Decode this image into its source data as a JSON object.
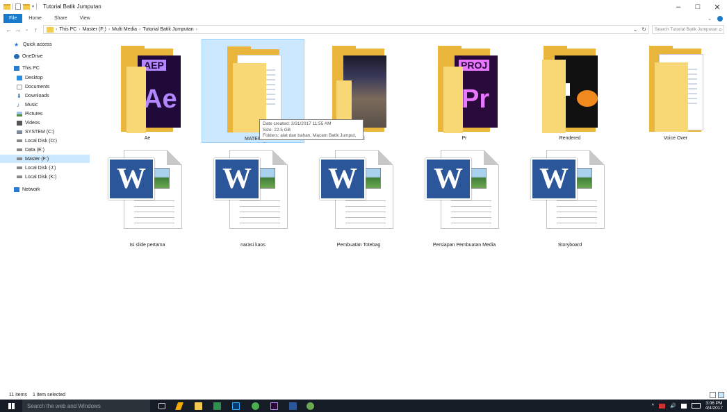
{
  "titlebar": {
    "title": "Tutorial Batik Jumputan",
    "controls": [
      "–",
      "□",
      "✕"
    ]
  },
  "ribbon": {
    "tabs": [
      "File",
      "Home",
      "Share",
      "View"
    ]
  },
  "address": {
    "crumbs": [
      "This PC",
      "Master (F:)",
      "Multi Media",
      "Tutorial Batik Jumputan"
    ],
    "search_placeholder": "Search Tutorial Batik Jumputan"
  },
  "navpane": {
    "items": [
      "Quick access",
      "OneDrive",
      "This PC",
      "Desktop",
      "Documents",
      "Downloads",
      "Music",
      "Pictures",
      "Videos",
      "SYSTEM (C:)",
      "Local Disk (D:)",
      "Data (E:)",
      "Master (F:)",
      "Local Disk (J:)",
      "Local Disk (K:)",
      "Network"
    ],
    "selected": "Master (F:)"
  },
  "items": [
    {
      "name": "Ae",
      "type": "folder",
      "art": "ae",
      "art_text": "AEP",
      "art_big": "Ae"
    },
    {
      "name": "MATERI",
      "type": "folder",
      "art": "doc",
      "selected": true
    },
    {
      "name": "Music",
      "type": "folder",
      "art": "picture"
    },
    {
      "name": "Pr",
      "type": "folder",
      "art": "pr",
      "art_text": "PROJ",
      "art_big": "Pr"
    },
    {
      "name": "Rendered",
      "type": "folder",
      "art": "rendered"
    },
    {
      "name": "Voice Over",
      "type": "folder",
      "art": "doc"
    },
    {
      "name": "Isi slide pertama",
      "type": "word-doc"
    },
    {
      "name": "narasi kaos",
      "type": "word-doc"
    },
    {
      "name": "Pembuatan Totebag",
      "type": "word-doc"
    },
    {
      "name": "Persiapan Pembuatan Media",
      "type": "word-doc"
    },
    {
      "name": "Storyboard",
      "type": "word-doc"
    }
  ],
  "tooltip": {
    "line1": "Date created: 3/31/2017 11:55 AM",
    "line2": "Size: 22.5 GB",
    "line3": "Folders: alat dan bahan, Macam Batik Jumput, ..."
  },
  "statusbar": {
    "count": "11 items",
    "selection": "1 item selected"
  },
  "taskbar": {
    "search_placeholder": "Search the web and Windows",
    "time": "3:06 PM",
    "date": "4/4/2017"
  }
}
